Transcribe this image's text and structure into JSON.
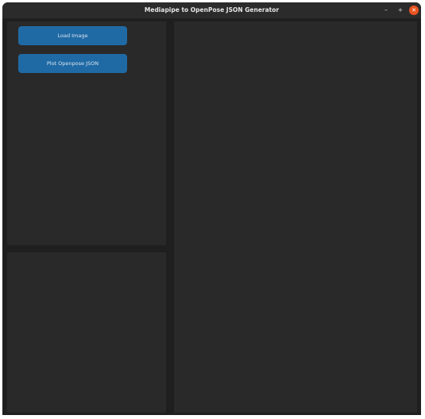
{
  "window": {
    "title": "Mediapipe to OpenPose JSON Generator",
    "controls": {
      "minimize": "–",
      "maximize": "+",
      "close": "✕"
    }
  },
  "sidebar": {
    "buttons": [
      {
        "label": "Load Image"
      },
      {
        "label": "Plot Openpose JSON"
      }
    ]
  },
  "colors": {
    "button_accent": "#1f6aa5",
    "panel_bg": "#292929",
    "window_bg": "#1f1f1f",
    "close_button": "#e95420"
  }
}
